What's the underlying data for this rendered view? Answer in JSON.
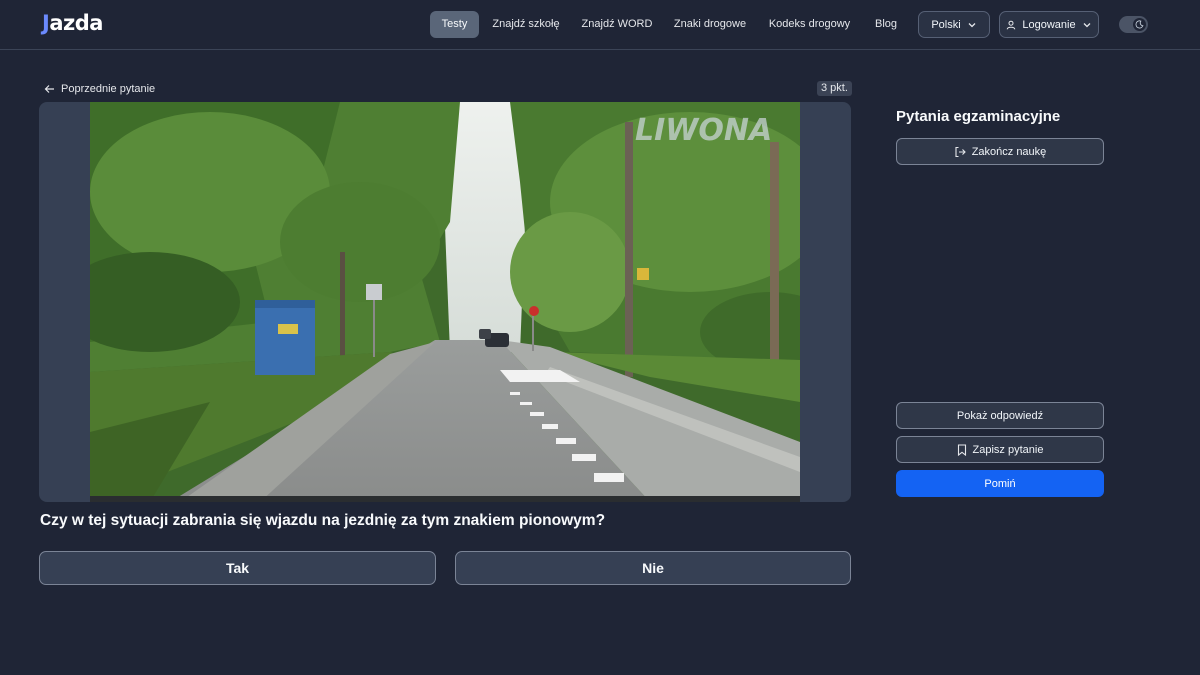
{
  "app": {
    "logo": "jazda",
    "logo_first": "J",
    "logo_rest": "azda"
  },
  "nav": {
    "items": [
      {
        "label": "Testy",
        "active": true
      },
      {
        "label": "Znajdź szkołę",
        "active": false
      },
      {
        "label": "Znajdź WORD",
        "active": false
      },
      {
        "label": "Znaki drogowe",
        "active": false
      },
      {
        "label": "Kodeks drogowy",
        "active": false
      },
      {
        "label": "Blog",
        "active": false
      }
    ],
    "language": "Polski",
    "login": "Logowanie",
    "theme_toggle": {
      "icon": "moon-icon",
      "state": "dark"
    }
  },
  "question_view": {
    "back_label": "Poprzednie pytanie",
    "points": "3 pkt.",
    "image_watermark": "LIWONA",
    "question": "Czy w tej sytuacji zabrania się wjazdu na jezdnię za tym znakiem pionowym?",
    "answers": [
      "Tak",
      "Nie"
    ]
  },
  "sidebar": {
    "title": "Pytania egzaminacyjne",
    "end_label": "Zakończ naukę",
    "show_answer_label": "Pokaż odpowiedź",
    "save_label": "Zapisz pytanie",
    "skip_label": "Pomiń"
  },
  "colors": {
    "background": "#1f2536",
    "primary": "#1463f3",
    "active_nav": "#5a6679",
    "logo_accent": "#6b8afd"
  }
}
